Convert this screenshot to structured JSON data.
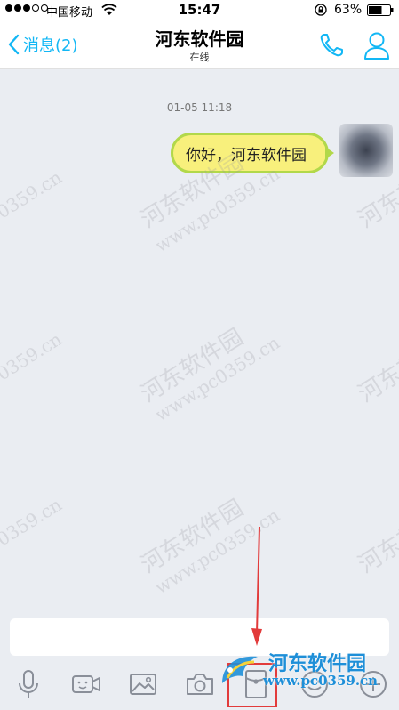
{
  "status_bar": {
    "carrier": "中国移动",
    "time": "15:47",
    "battery_percent": "63%",
    "battery_level": 0.63
  },
  "nav": {
    "back_label": "消息(2)",
    "title": "河东软件园",
    "subtitle": "在线"
  },
  "chat": {
    "timestamp": "01-05 11:18",
    "messages": [
      {
        "text": "你好，河东软件园",
        "sender": "self"
      }
    ]
  },
  "input": {
    "placeholder": ""
  },
  "toolbar": {
    "items": [
      "microphone-icon",
      "video-icon",
      "image-icon",
      "camera-icon",
      "red-packet-icon",
      "emoji-icon",
      "plus-icon"
    ]
  },
  "watermarks": {
    "tile_cn": "河东软件园",
    "tile_url": "www.pc0359.cn",
    "corner_url": "0359.cn",
    "brand_name": "河东软件园",
    "brand_url": "www.pc0359.cn"
  },
  "colors": {
    "accent": "#12b7f5",
    "bubble_fill": "#f8f07c",
    "bubble_border": "#b2d84a",
    "background": "#eaedf2",
    "annotation_red": "#e23b3b",
    "brand_blue": "#1e8fd8"
  }
}
